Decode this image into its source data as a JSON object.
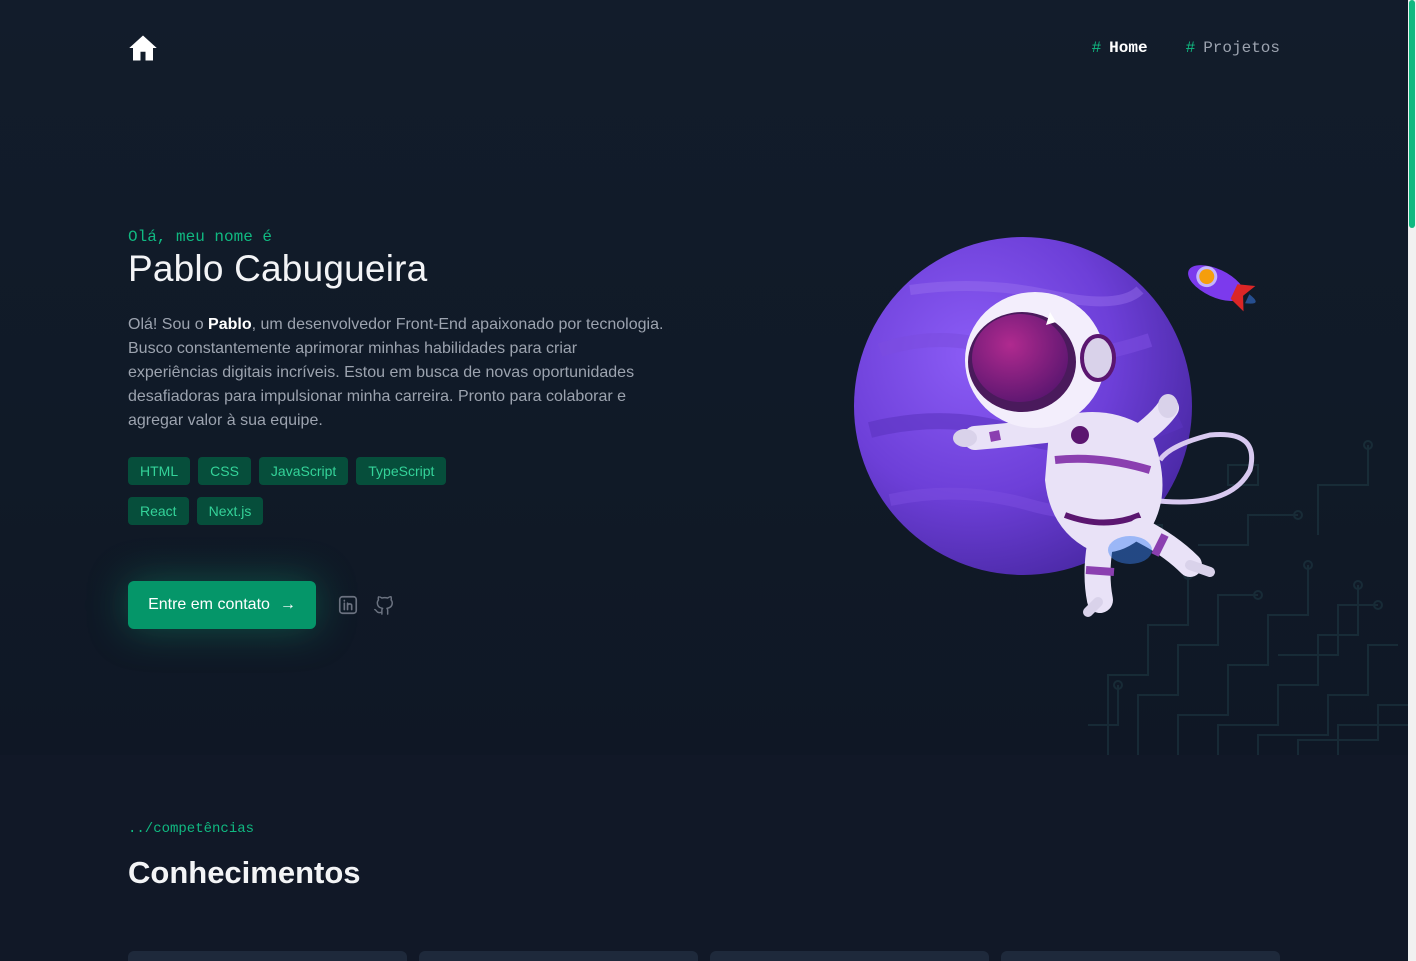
{
  "nav": {
    "hash": "#",
    "items": [
      {
        "label": "Home",
        "active": true
      },
      {
        "label": "Projetos",
        "active": false
      }
    ]
  },
  "hero": {
    "greeting": "Olá, meu nome é",
    "name": "Pablo Cabugueira",
    "bio_prefix": "Olá! Sou o ",
    "bio_highlight": "Pablo",
    "bio_suffix": ", um desenvolvedor Front-End apaixonado por tecnologia. Busco constantemente aprimorar minhas habilidades para criar experiências digitais incríveis. Estou em busca de novas oportunidades desafiadoras para impulsionar minha carreira. Pronto para colaborar e agregar valor à sua equipe.",
    "tags": [
      "HTML",
      "CSS",
      "JavaScript",
      "TypeScript",
      "React",
      "Next.js"
    ],
    "cta_label": "Entre em contato",
    "cta_arrow": "→"
  },
  "icons": {
    "home": "home-icon",
    "linkedin": "linkedin-icon",
    "github": "github-icon"
  },
  "section": {
    "path": "../competências",
    "title": "Conhecimentos"
  },
  "colors": {
    "accent": "#10b981",
    "background": "#111827",
    "tag_bg": "#064e3b",
    "button": "#059669"
  }
}
